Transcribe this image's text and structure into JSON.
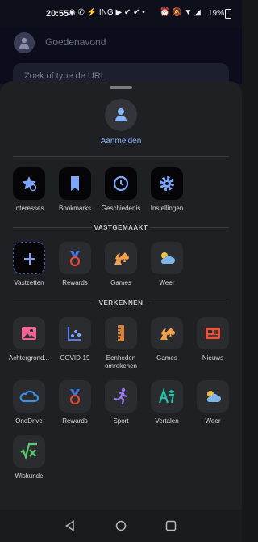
{
  "status": {
    "time": "20:55",
    "left_icons": "◉ ✆ ⚡ ING ▶ ✔ ✔ •",
    "right_icons": "⏰ 🔕 ▼ ◢",
    "battery": "19%"
  },
  "background": {
    "greeting": "Goedenavond",
    "search_placeholder": "Zoek of type de URL"
  },
  "sheet": {
    "login_label": "Aanmelden"
  },
  "quick_actions": [
    {
      "label": "Interesses",
      "icon": "star-settings-icon"
    },
    {
      "label": "Bookmarks",
      "icon": "bookmark-icon"
    },
    {
      "label": "Geschiedenis",
      "icon": "history-icon"
    },
    {
      "label": "Instellingen",
      "icon": "gear-icon"
    }
  ],
  "pinned": {
    "heading": "VASTGEMAAKT",
    "items": [
      {
        "label": "Vastzetten",
        "icon": "plus-icon"
      },
      {
        "label": "Rewards",
        "icon": "medal-icon"
      },
      {
        "label": "Games",
        "icon": "chess-spade-icon"
      },
      {
        "label": "Weer",
        "icon": "weather-icon"
      }
    ]
  },
  "explore": {
    "heading": "VERKENNEN",
    "items": [
      {
        "label": "Achtergrond...",
        "icon": "wallpaper-icon"
      },
      {
        "label": "COVID-19",
        "icon": "covid-chart-icon"
      },
      {
        "label": "Eenheden omrekenen",
        "icon": "ruler-icon"
      },
      {
        "label": "Games",
        "icon": "chess-spade-icon"
      },
      {
        "label": "Nieuws",
        "icon": "news-icon"
      },
      {
        "label": "OneDrive",
        "icon": "onedrive-icon"
      },
      {
        "label": "Rewards",
        "icon": "medal-icon"
      },
      {
        "label": "Sport",
        "icon": "sport-runner-icon"
      },
      {
        "label": "Vertalen",
        "icon": "translate-icon"
      },
      {
        "label": "Weer",
        "icon": "weather-icon"
      },
      {
        "label": "Wiskunde",
        "icon": "math-icon"
      }
    ]
  },
  "colors": {
    "accent_blue": "#8ab4f8",
    "medal_blue": "#3f6fd8",
    "medal_red": "#e04a3a",
    "games_orange": "#f0a24a",
    "teal": "#22c3a8",
    "pink": "#f06292"
  }
}
